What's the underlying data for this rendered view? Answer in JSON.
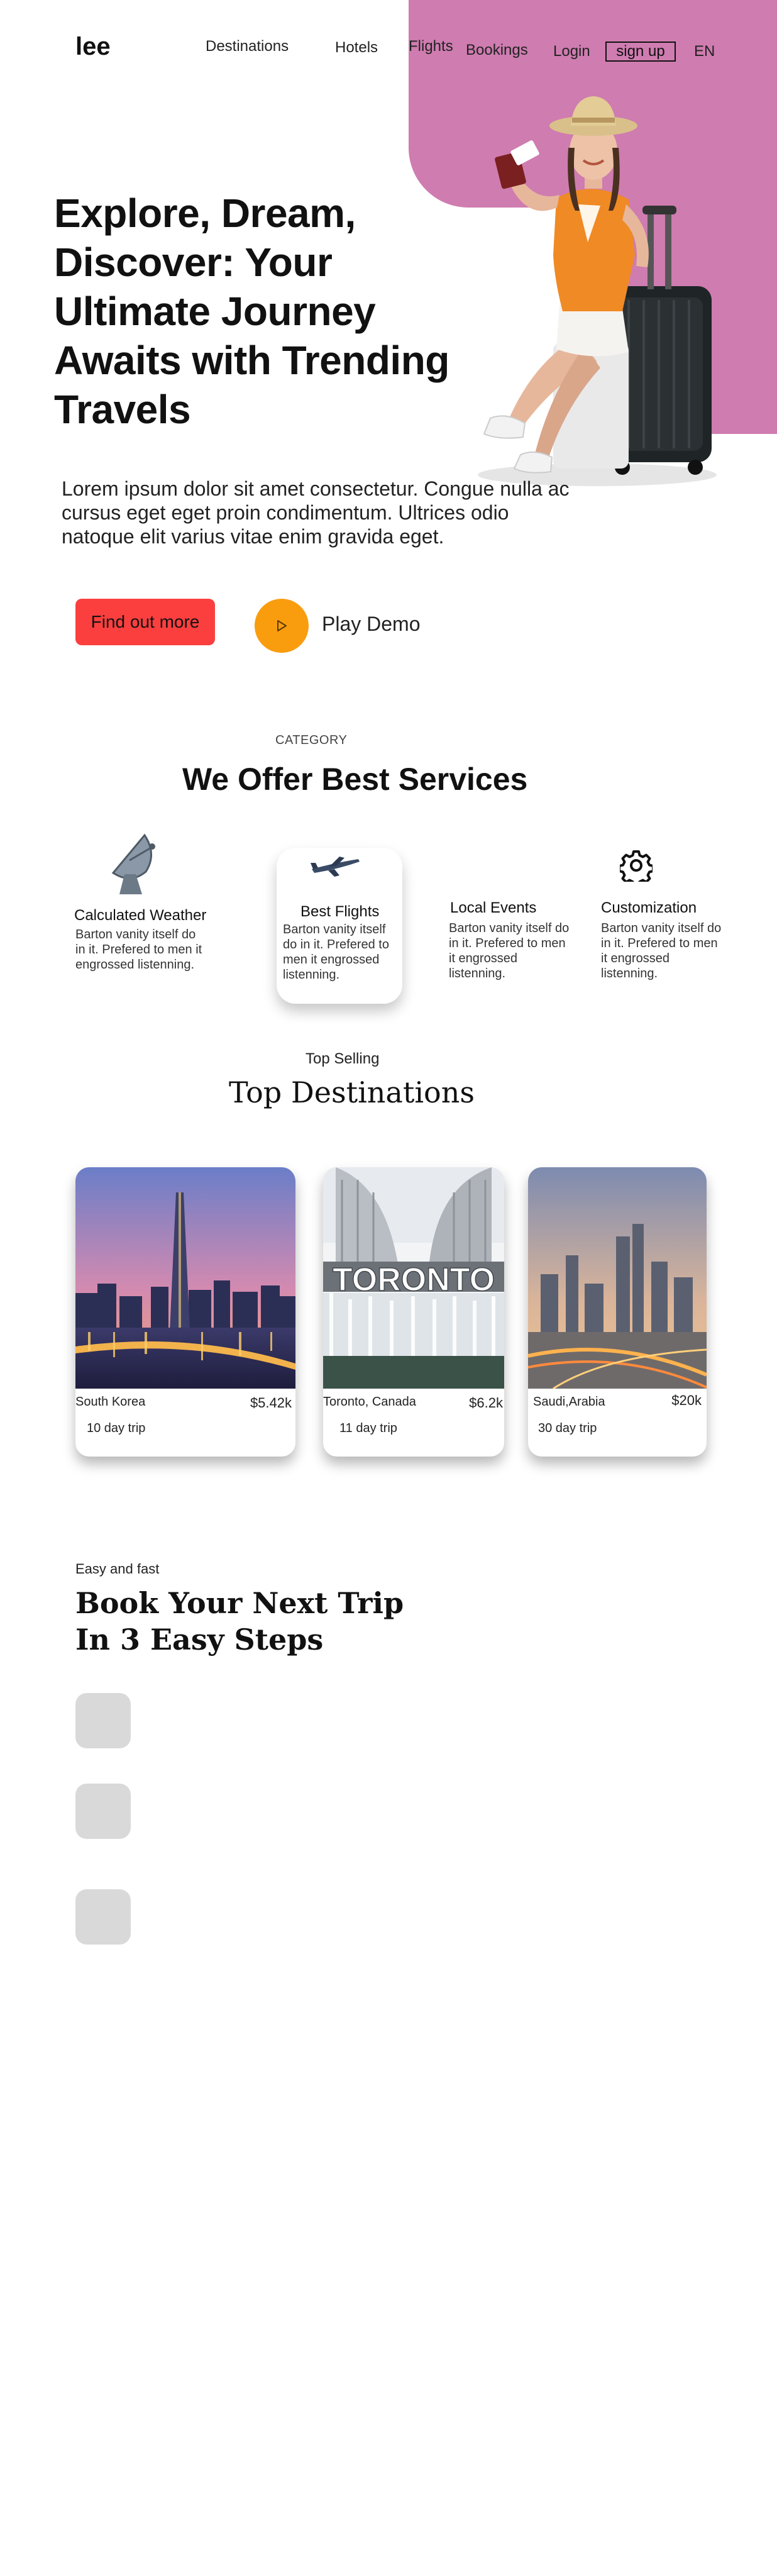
{
  "header": {
    "logo": "lee",
    "nav": {
      "destinations": "Destinations",
      "hotels": "Hotels",
      "flights": "Flights",
      "bookings": "Bookings",
      "login": "Login",
      "signup": "sign up",
      "language": "EN"
    }
  },
  "hero": {
    "title": "Explore, Dream, Discover: Your Ultimate Journey Awaits with Trending Travels",
    "text": "Lorem ipsum dolor sit amet consectetur. Congue nulla ac cursus eget eget proin condimentum. Ultrices odio natoque elit varius vitae enim gravida eget.",
    "cta_label": "Find out more",
    "play_label": "Play Demo"
  },
  "services": {
    "eyebrow": "CATEGORY",
    "title": "We Offer Best Services",
    "items": [
      {
        "title": "Calculated Weather",
        "text": "Barton vanity itself do in it. Prefered to men it engrossed listenning.",
        "icon": "satellite-dish-icon"
      },
      {
        "title": "Best Flights",
        "text": "Barton vanity itself do in it. Prefered to men it engrossed listenning.",
        "icon": "airplane-icon"
      },
      {
        "title": "Local Events",
        "text": "Barton vanity itself do in it. Prefered to men it engrossed listenning.",
        "icon": "microphone-icon"
      },
      {
        "title": "Customization",
        "text": "Barton vanity itself do in it. Prefered to men it engrossed listenning.",
        "icon": "gear-icon"
      }
    ]
  },
  "destinations": {
    "eyebrow": "Top Selling",
    "title": "Top Destinations",
    "items": [
      {
        "name": "South Korea",
        "price": "$5.42k",
        "trip": "10 day trip"
      },
      {
        "name": "Toronto, Canada",
        "price": "$6.2k",
        "trip": "11 day trip",
        "sign_text": "TORONTO"
      },
      {
        "name": "Saudi,Arabia",
        "price": "$20k",
        "trip": "30 day trip"
      }
    ]
  },
  "steps": {
    "eyebrow": "Easy and fast",
    "title_line1": "Book Your Next Trip",
    "title_line2": "In 3 Easy Steps"
  },
  "colors": {
    "accent_pink": "#cf7cb0",
    "cta_red": "#fb3f3f",
    "play_orange": "#f99d0f"
  }
}
